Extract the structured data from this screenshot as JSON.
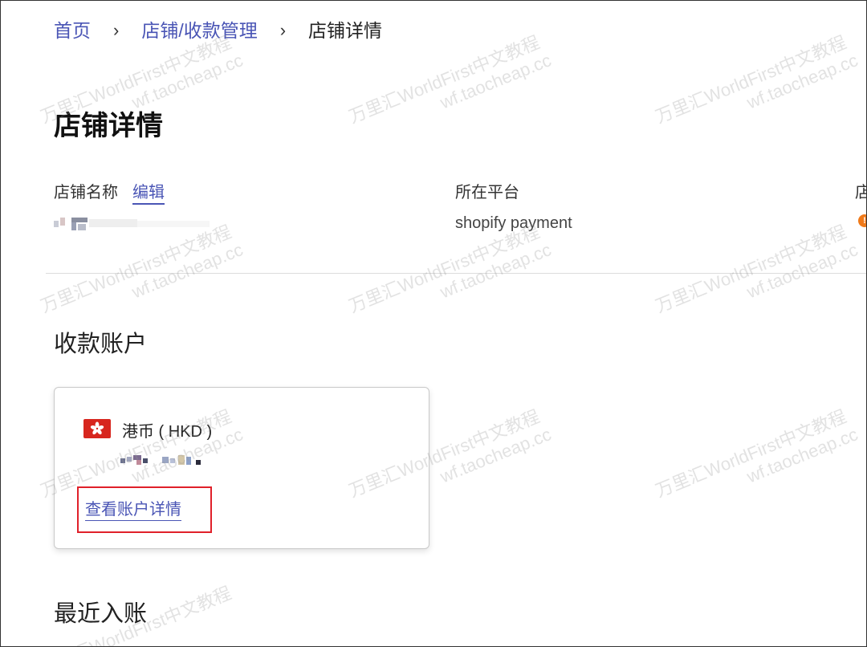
{
  "breadcrumb": {
    "home": "首页",
    "shop_payment_mgmt": "店铺/收款管理",
    "current": "店铺详情",
    "separator": "›"
  },
  "page_title": "店铺详情",
  "store_info": {
    "name_label": "店铺名称",
    "edit_label": "编辑",
    "platform_label": "所在平台",
    "platform_value": "shopify payment",
    "status_label_partial": "店",
    "status_icon": "warning-icon"
  },
  "receiving_account": {
    "section_title": "收款账户",
    "currency_label": "港币 ( HKD )",
    "flag_icon": "hong-kong-flag-icon",
    "view_details_label": "查看账户详情"
  },
  "recent_deposits": {
    "section_title": "最近入账"
  },
  "watermark": {
    "line1": "万里汇WorldFirst中文教程",
    "line2": "wf.taocheap.cc"
  },
  "colors": {
    "link": "#4a55b5",
    "highlight_border": "#e0202a",
    "flag_red": "#d7261e",
    "warning_orange": "#f07a1a"
  }
}
